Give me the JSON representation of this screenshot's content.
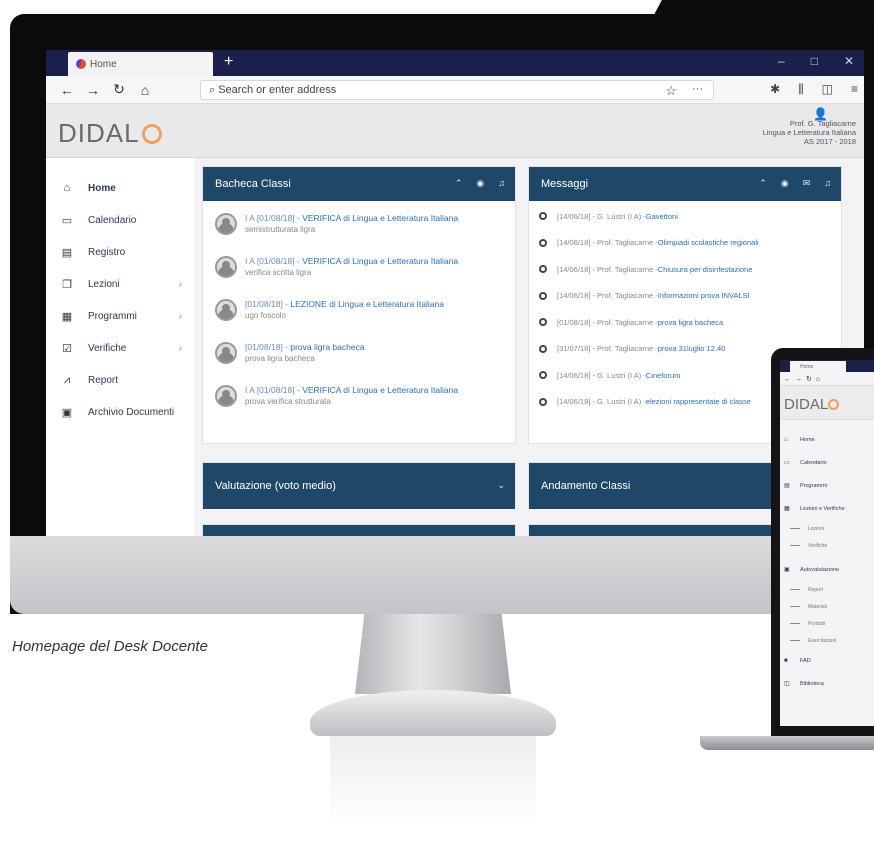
{
  "browser": {
    "tab_title": "Home",
    "new_tab": "+",
    "window_controls": [
      "–",
      "□",
      "✕"
    ],
    "address_placeholder": "Search or enter address",
    "nav_icons": [
      "back-icon",
      "forward-icon",
      "reload-icon",
      "home-icon"
    ],
    "toolbar_icons": [
      "star-icon",
      "more-icon",
      "extension-icon",
      "library-icon",
      "sidebar-icon",
      "menu-icon"
    ]
  },
  "app": {
    "logo": "DIDAL",
    "user": {
      "name": "Prof. G. Tagliacarne",
      "subject": "Lingua e Letteratura Italiana",
      "year": "AS 2017 - 2018"
    }
  },
  "sidebar": {
    "items": [
      {
        "label": "Home",
        "icon": "home-icon",
        "has_children": false
      },
      {
        "label": "Calendario",
        "icon": "calendar-icon",
        "has_children": false
      },
      {
        "label": "Registro",
        "icon": "register-icon",
        "has_children": false
      },
      {
        "label": "Lezioni",
        "icon": "lessons-icon",
        "has_children": true
      },
      {
        "label": "Programmi",
        "icon": "programs-icon",
        "has_children": true
      },
      {
        "label": "Verifiche",
        "icon": "tests-icon",
        "has_children": true
      },
      {
        "label": "Report",
        "icon": "report-icon",
        "has_children": false
      },
      {
        "label": "Archivio Documenti",
        "icon": "archive-icon",
        "has_children": false
      }
    ],
    "chevron": "›"
  },
  "panels": {
    "bacheca": {
      "title": "Bacheca Classi",
      "posts": [
        {
          "ref": "I A [01/08/18] - ",
          "title": "VERIFICA di Lingua e Letteratura Italiana",
          "sub": "semistrutturata ligra"
        },
        {
          "ref": "I A [01/08/18] - ",
          "title": "VERIFICA di Lingua e Letteratura Italiana",
          "sub": "verifica scritta ligra"
        },
        {
          "ref": "[01/08/18] - ",
          "title": "LEZIONE di Lingua e Letteratura Italiana",
          "sub": "ugo foscolo"
        },
        {
          "ref": "[01/08/18] - ",
          "title": "prova ligra bacheca",
          "sub": "prova ligra bacheca"
        },
        {
          "ref": "I A [01/08/18] - ",
          "title": "VERIFICA di Lingua e Letteratura Italiana",
          "sub": "prova verifica strutturata"
        }
      ]
    },
    "messaggi": {
      "title": "Messaggi",
      "items": [
        {
          "meta": "[14/06/18] - G. Lustri (I A) - ",
          "subject": "Gavettoni"
        },
        {
          "meta": "[14/06/18] - Prof. Tagliacarne - ",
          "subject": "Olimpiadi scolastiche regionali"
        },
        {
          "meta": "[14/06/18] - Prof. Tagliacarne - ",
          "subject": "Chiusura per disinfestazione"
        },
        {
          "meta": "[14/06/18] - Prof. Tagliacarne - ",
          "subject": "Informazioni prova INVALSI"
        },
        {
          "meta": "[01/08/18] - Prof. Tagliacarne - ",
          "subject": "prova ligra bacheca"
        },
        {
          "meta": "[31/07/18] - Prof. Tagliacarne - ",
          "subject": "prova 31luglio 12.40"
        },
        {
          "meta": "[14/06/18] - G. Lustri (I A) - ",
          "subject": "Cineforum"
        },
        {
          "meta": "[14/06/18] - G. Lustri (I A) - ",
          "subject": "elezioni rappresentate di classe"
        }
      ]
    },
    "valutazione": {
      "title": "Valutazione (voto medio)"
    },
    "andamento": {
      "title": "Andamento Classi"
    }
  },
  "caption": "Homepage del Desk Docente",
  "laptop": {
    "tab_title": "Home",
    "logo": "DIDAL",
    "items": [
      {
        "label": "Home",
        "type": "item"
      },
      {
        "label": "Calendario",
        "type": "item"
      },
      {
        "label": "Programmi",
        "type": "item"
      },
      {
        "label": "Lezioni e Verifiche",
        "type": "item"
      },
      {
        "label": "Lezioni",
        "type": "sub"
      },
      {
        "label": "Verifiche",
        "type": "sub"
      },
      {
        "label": "Autovalutazione",
        "type": "item"
      },
      {
        "label": "Report",
        "type": "sub"
      },
      {
        "label": "Materiali",
        "type": "sub"
      },
      {
        "label": "Prodotti",
        "type": "sub"
      },
      {
        "label": "Esercitazioni",
        "type": "sub"
      },
      {
        "label": "FAD",
        "type": "item"
      },
      {
        "label": "Biblioteca",
        "type": "item"
      }
    ]
  },
  "colors": {
    "panel_header": "#1f4868",
    "tabbar": "#1c1f4a",
    "link": "#2d6fb7",
    "logo_accent": "#f0a058"
  }
}
